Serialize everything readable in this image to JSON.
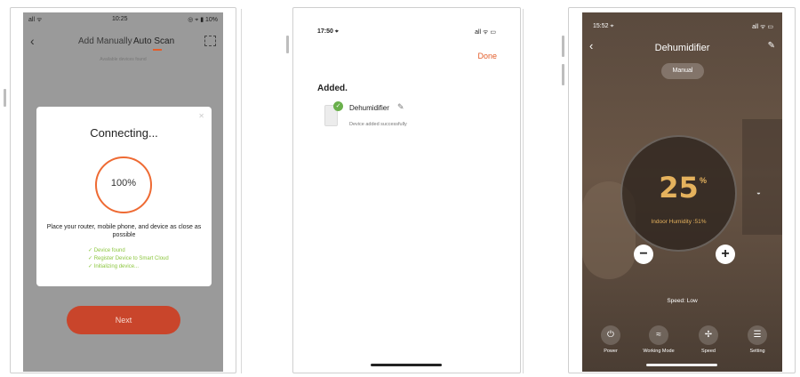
{
  "screen1": {
    "status": {
      "left": "all ᯤ",
      "time": "10:25",
      "right": "◎ ⌖ ▮ 10%"
    },
    "nav": {
      "back": "‹",
      "tab_manual": "Add Manually",
      "tab_auto": "Auto Scan"
    },
    "hint": "Available devices found",
    "dialog": {
      "title": "Connecting...",
      "percent": "100%",
      "message": "Place your router, mobile phone, and device as close as possible",
      "steps": [
        "✓ Device found",
        "✓ Register Device to Smart Cloud",
        "✓ Initializing device..."
      ]
    },
    "next": "Next",
    "colors": {
      "accent": "#e35d2a",
      "button": "#c9452b",
      "step": "#8cc63f"
    }
  },
  "screen2": {
    "time": "17:50 ⌖",
    "signal": "all ᯤ ▭",
    "done": "Done",
    "added_title": "Added.",
    "device_name": "Dehumidifier",
    "device_status": "Device added successfully",
    "check": "✓",
    "edit_icon": "✎"
  },
  "screen3": {
    "time": "15:52 ⌖",
    "signal": "all ᯤ ▭",
    "back": "‹",
    "title": "Dehumidifier",
    "edit_icon": "✎",
    "mode": "Manual",
    "setpoint": "25",
    "unit": "%",
    "humidity": "Indoor Humidity :51%",
    "minus": "−",
    "plus": "+",
    "speed": "Speed: Low",
    "controls": [
      {
        "label": "Power",
        "icon": "⏻"
      },
      {
        "label": "Working Mode",
        "icon": "≈"
      },
      {
        "label": "Speed",
        "icon": "✢"
      },
      {
        "label": "Setting",
        "icon": "☰"
      }
    ]
  }
}
